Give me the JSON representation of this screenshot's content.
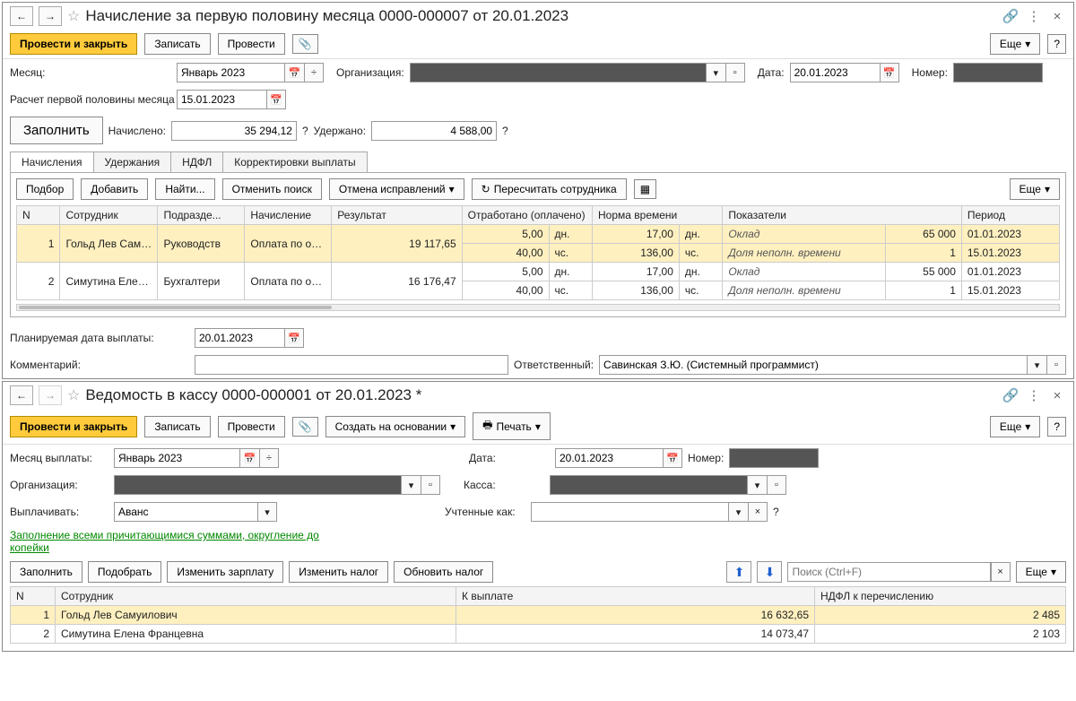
{
  "win1": {
    "title": "Начисление за первую половину месяца 0000-000007 от 20.01.2023",
    "btn_post_close": "Провести и закрыть",
    "btn_write": "Записать",
    "btn_post": "Провести",
    "btn_more": "Еще",
    "lbl_month": "Месяц:",
    "month": "Январь 2023",
    "lbl_org": "Организация:",
    "lbl_date": "Дата:",
    "date": "20.01.2023",
    "lbl_num": "Номер:",
    "lbl_calc_to": "Расчет первой половины месяца до:",
    "calc_to": "15.01.2023",
    "btn_fill": "Заполнить",
    "lbl_accrued": "Начислено:",
    "accrued": "35 294,12",
    "lbl_withheld": "Удержано:",
    "withheld": "4 588,00",
    "tabs": [
      "Начисления",
      "Удержания",
      "НДФЛ",
      "Корректировки выплаты"
    ],
    "btn_select": "Подбор",
    "btn_add": "Добавить",
    "btn_find": "Найти...",
    "btn_cancel_search": "Отменить поиск",
    "btn_cancel_fix": "Отмена исправлений",
    "btn_recalc": "Пересчитать сотрудника",
    "headers": [
      "N",
      "Сотрудник",
      "Подразде...",
      "Начисление",
      "Результат",
      "Отработано (оплачено)",
      "Норма времени",
      "Показатели",
      "Период"
    ],
    "rows": [
      {
        "n": "1",
        "emp": "Гольд Лев Самуилови",
        "dep": "Руководств",
        "type": "Оплата по окладу",
        "res": "19 117,65",
        "w1": "5,00",
        "wu1": "дн.",
        "n1": "17,00",
        "nu1": "дн.",
        "ind": "Оклад",
        "iv": "65 000",
        "per": "01.01.2023",
        "w2": "40,00",
        "wu2": "чс.",
        "n2": "136,00",
        "nu2": "чс.",
        "ind2": "Доля неполн. времени",
        "iv2": "1",
        "per2": "15.01.2023"
      },
      {
        "n": "2",
        "emp": "Симутина Елена ...",
        "dep": "Бухгалтери",
        "type": "Оплата по окладу",
        "res": "16 176,47",
        "w1": "5,00",
        "wu1": "дн.",
        "n1": "17,00",
        "nu1": "дн.",
        "ind": "Оклад",
        "iv": "55 000",
        "per": "01.01.2023",
        "w2": "40,00",
        "wu2": "чс.",
        "n2": "136,00",
        "nu2": "чс.",
        "ind2": "Доля неполн. времени",
        "iv2": "1",
        "per2": "15.01.2023"
      }
    ],
    "lbl_plan_date": "Планируемая дата выплаты:",
    "plan_date": "20.01.2023",
    "lbl_comment": "Комментарий:",
    "lbl_resp": "Ответственный:",
    "resp": "Савинская З.Ю. (Системный программист)"
  },
  "win2": {
    "title": "Ведомость в кассу 0000-000001 от 20.01.2023 *",
    "btn_post_close": "Провести и закрыть",
    "btn_write": "Записать",
    "btn_post": "Провести",
    "btn_create_based": "Создать на основании",
    "btn_print": "Печать",
    "btn_more": "Еще",
    "lbl_month": "Месяц выплаты:",
    "month": "Январь 2023",
    "lbl_date": "Дата:",
    "date": "20.01.2023",
    "lbl_num": "Номер:",
    "lbl_org": "Организация:",
    "lbl_kassa": "Касса:",
    "lbl_pay": "Выплачивать:",
    "pay": "Аванс",
    "lbl_accounted": "Учтенные как:",
    "link": "Заполнение всеми причитающимися суммами, округление до копейки",
    "btn_fill": "Заполнить",
    "btn_select": "Подобрать",
    "btn_edit_salary": "Изменить зарплату",
    "btn_edit_tax": "Изменить налог",
    "btn_update_tax": "Обновить налог",
    "search_placeholder": "Поиск (Ctrl+F)",
    "headers": [
      "N",
      "Сотрудник",
      "К выплате",
      "НДФЛ к перечислению"
    ],
    "rows": [
      {
        "n": "1",
        "emp": "Гольд Лев Самуилович",
        "pay": "16 632,65",
        "tax": "2 485"
      },
      {
        "n": "2",
        "emp": "Симутина Елена Францевна",
        "pay": "14 073,47",
        "tax": "2 103"
      }
    ]
  }
}
